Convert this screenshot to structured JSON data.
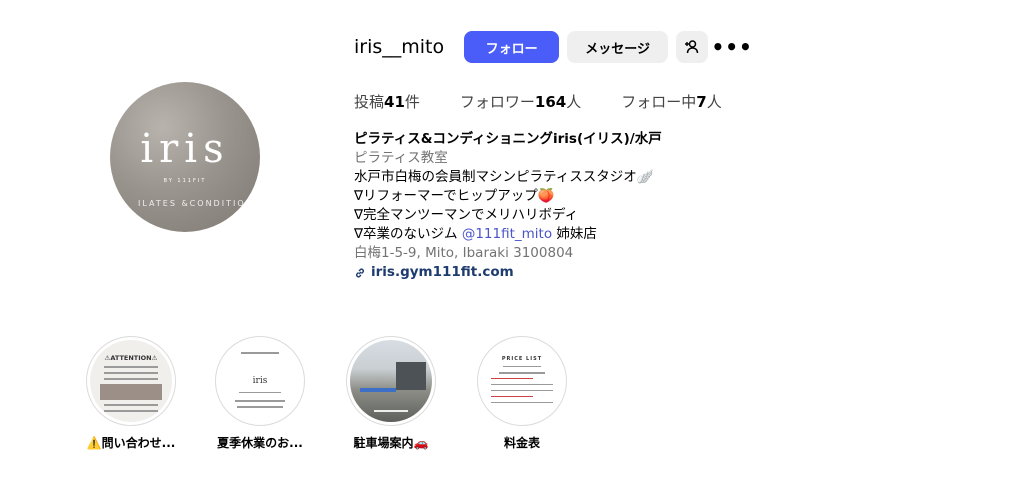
{
  "profile": {
    "username": "iris__mito",
    "follow_label": "フォロー",
    "message_label": "メッセージ",
    "more_label": "•••",
    "avatar": {
      "brand": "iris",
      "brand_sub": "BY 111FIT",
      "brand_line": "ILATES &CONDITIONIN"
    }
  },
  "stats": {
    "posts_prefix": "投稿",
    "posts_count": "41",
    "posts_suffix": "件",
    "followers_prefix": "フォロワー",
    "followers_count": "164",
    "followers_suffix": "人",
    "following_prefix": "フォロー中",
    "following_count": "7",
    "following_suffix": "人"
  },
  "bio": {
    "name": "ピラティス&コンディショニングiris(イリス)/水戸",
    "category": "ピラティス教室",
    "line1": "水戸市白梅の会員制マシンピラティススタジオ🪽",
    "line2": "∇リフォーマーでヒップアップ🍑",
    "line3": "∇完全マンツーマンでメリハリボディ",
    "line4_prefix": "∇卒業のないジム ",
    "line4_mention": "@111fit_mito",
    "line4_suffix": " 姉妹店",
    "address": "白梅1-5-9, Mito, Ibaraki 3100804",
    "link": "iris.gym111fit.com"
  },
  "highlights": [
    {
      "label": "⚠️問い合わせ...",
      "cover_text": "⚠ATTENTION⚠"
    },
    {
      "label": "夏季休業のお...",
      "cover_text": "iris"
    },
    {
      "label": "駐車場案内🚗",
      "cover_text": ""
    },
    {
      "label": "料金表",
      "cover_text": "PRICE LIST"
    }
  ]
}
